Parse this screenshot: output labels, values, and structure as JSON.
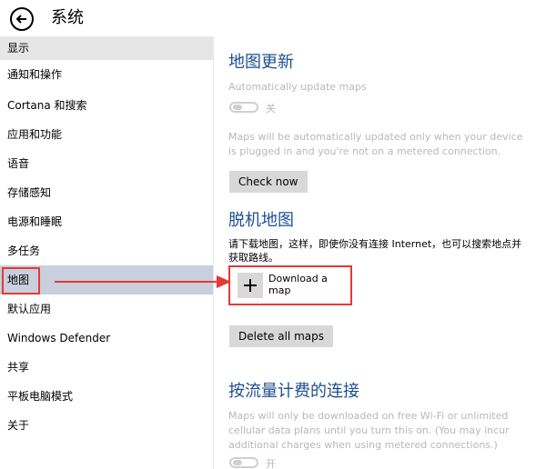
{
  "window": {
    "title": "系统"
  },
  "sidebar": {
    "items": [
      {
        "label": "显示"
      },
      {
        "label": "通知和操作"
      },
      {
        "label": "Cortana 和搜索"
      },
      {
        "label": "应用和功能"
      },
      {
        "label": "语音"
      },
      {
        "label": "存储感知"
      },
      {
        "label": "电源和睡眠"
      },
      {
        "label": "多任务"
      },
      {
        "label": "地图"
      },
      {
        "label": "默认应用"
      },
      {
        "label": "Windows Defender"
      },
      {
        "label": "共享"
      },
      {
        "label": "平板电脑模式"
      },
      {
        "label": "关于"
      }
    ],
    "selected_index": 8
  },
  "main": {
    "map_updates": {
      "heading": "地图更新",
      "toggle_caption": "Automatically update maps",
      "toggle_state": "关",
      "description": "Maps will be automatically updated only when your device is plugged in and you're not on a metered connection.",
      "button": "Check now"
    },
    "offline_maps": {
      "heading": "脱机地图",
      "description": "请下载地图，这样，即使你没有连接 Internet，也可以搜索地点并获取路线。",
      "download_label": "Download a map",
      "delete_button": "Delete all maps"
    },
    "metered": {
      "heading": "按流量计费的连接",
      "description": "Maps will only be downloaded on free Wi-Fi or unlimited cellular data plans until you turn this on. (You may incur additional charges when using metered connections.)",
      "toggle_state": "开"
    }
  },
  "colors": {
    "heading": "#1f4f8f",
    "selected_nav": "#c9cfdc",
    "annotation": "#e53935",
    "button": "#d8d8d8"
  }
}
